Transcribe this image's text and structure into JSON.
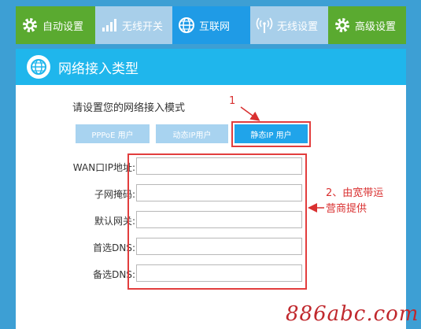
{
  "tabs": [
    {
      "label": "自动设置",
      "icon": "gear-icon"
    },
    {
      "label": "无线开关",
      "icon": "signal-bars-icon"
    },
    {
      "label": "互联网",
      "icon": "globe-icon"
    },
    {
      "label": "无线设置",
      "icon": "wifi-antenna-icon"
    },
    {
      "label": "高级设置",
      "icon": "gear-icon"
    }
  ],
  "panel": {
    "title": "网络接入类型",
    "prompt": "请设置您的网络接入模式",
    "modes": [
      "PPPoE 用户",
      "动态IP用户",
      "静态IP 用户"
    ],
    "selected_mode": "静态IP 用户",
    "fields": [
      {
        "label": "WAN口IP地址",
        "value": ""
      },
      {
        "label": "子网掩码",
        "value": ""
      },
      {
        "label": "默认网关",
        "value": ""
      },
      {
        "label": "首选DNS",
        "value": ""
      },
      {
        "label": "备选DNS",
        "value": ""
      }
    ]
  },
  "annotations": {
    "step1": "1",
    "step2_line1": "2、由宽带运",
    "step2_line2": "营商提供"
  },
  "watermark": "886abc.com",
  "colors": {
    "page_bg": "#3d9fd4",
    "header_blue": "#1fb6ec",
    "tab_green": "#5aaa30",
    "tab_active": "#1f9be6",
    "annotation_red": "#e23d3d"
  }
}
